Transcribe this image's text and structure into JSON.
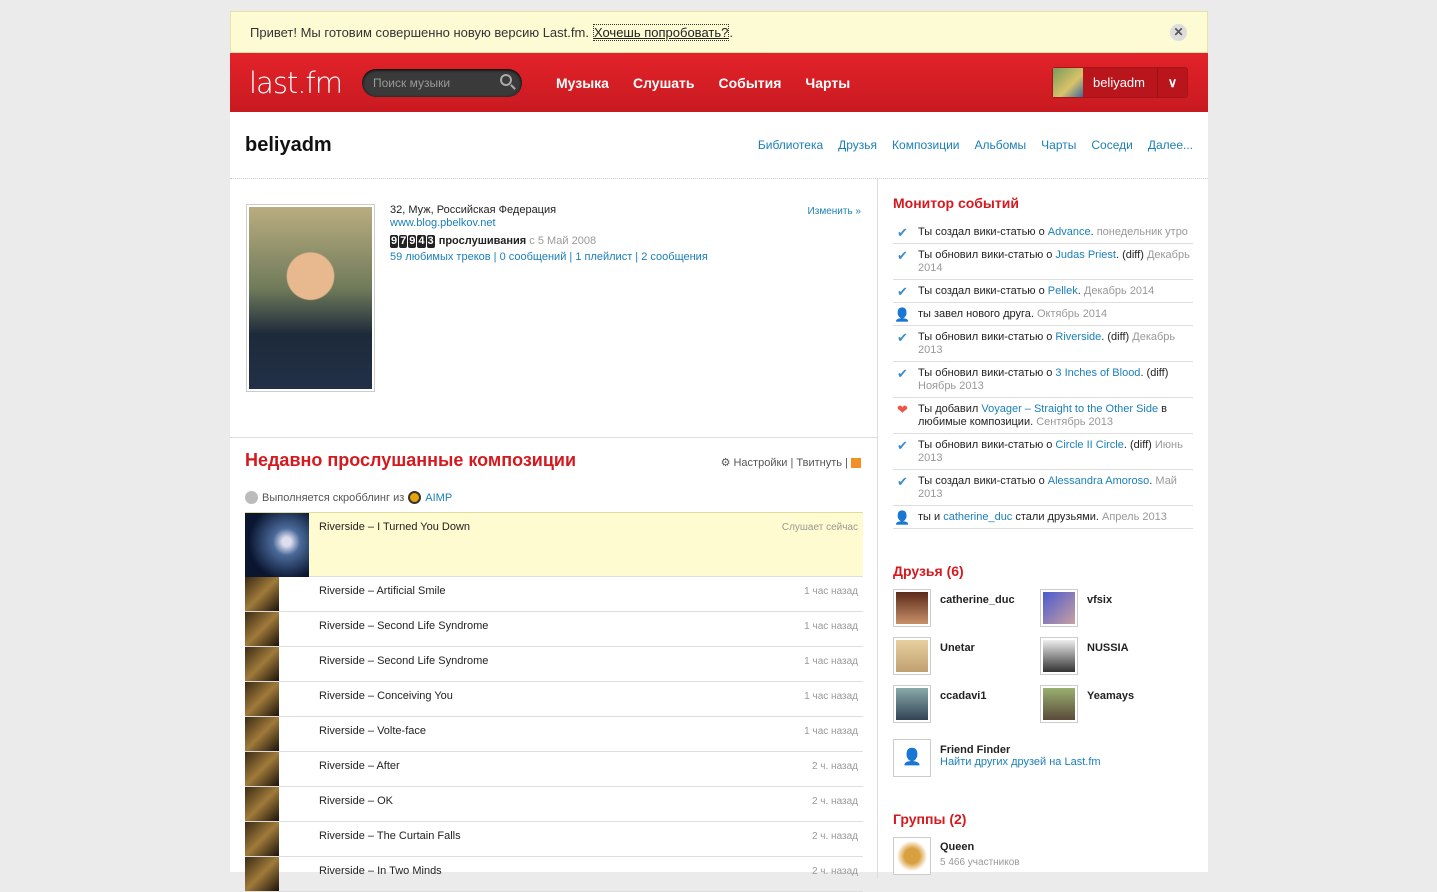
{
  "banner": {
    "text": "Привет! Мы готовим совершенно новую версию Last.fm.",
    "link": "Хочешь попробовать?",
    "after": ".",
    "close": "✕"
  },
  "header": {
    "logo": "last.fm",
    "search_placeholder": "Поиск музыки",
    "nav": [
      "Музыка",
      "Слушать",
      "События",
      "Чарты"
    ],
    "user": "beliyadm",
    "dropdown": "∨"
  },
  "profile": {
    "name": "beliyadm",
    "tabs": [
      "Библиотека",
      "Друзья",
      "Композиции",
      "Альбомы",
      "Чарты",
      "Соседи",
      "Далее..."
    ],
    "details": "32, Муж, Российская Федерация",
    "site": "www.blog.pbelkov.net",
    "edit": "Изменить »",
    "digits": [
      "9",
      "7",
      "9",
      "4",
      "3"
    ],
    "plays_label": "прослушивания",
    "since": "с 5 Май 2008",
    "stats": [
      "59 любимых треков",
      "0 сообщений",
      "1 плейлист",
      "2 сообщения"
    ],
    "sep": " | "
  },
  "recent": {
    "title": "Недавно прослушанные композиции",
    "settings": "⚙ Настройки",
    "tweet": "Твитнуть",
    "sep": " | ",
    "scrobbling": "Выполняется скробблинг из",
    "app": "AIMP",
    "tracks": [
      {
        "name": "Riverside – I Turned You Down",
        "time": "Слушает сейчас"
      },
      {
        "name": "Riverside – Artificial Smile",
        "time": "1 час назад"
      },
      {
        "name": "Riverside – Second Life Syndrome",
        "time": "1 час назад"
      },
      {
        "name": "Riverside – Second Life Syndrome",
        "time": "1 час назад"
      },
      {
        "name": "Riverside – Conceiving You",
        "time": "1 час назад"
      },
      {
        "name": "Riverside – Volte-face",
        "time": "1 час назад"
      },
      {
        "name": "Riverside – After",
        "time": "2 ч. назад"
      },
      {
        "name": "Riverside – OK",
        "time": "2 ч. назад"
      },
      {
        "name": "Riverside – The Curtain Falls",
        "time": "2 ч. назад"
      },
      {
        "name": "Riverside – In Two Minds",
        "time": "2 ч. назад"
      }
    ]
  },
  "events": {
    "title": "Монитор событий",
    "items": [
      {
        "icon": "check",
        "pre": "Ты создал вики-статью о ",
        "link": "Advance",
        "post": ". ",
        "date": "понедельник утро"
      },
      {
        "icon": "check",
        "pre": "Ты обновил вики-статью о ",
        "link": "Judas Priest",
        "post": ". (diff) ",
        "date": "Декабрь 2014"
      },
      {
        "icon": "check",
        "pre": "Ты создал вики-статью о ",
        "link": "Pellek",
        "post": ". ",
        "date": "Декабрь 2014"
      },
      {
        "icon": "person",
        "pre": "ты завел нового друга. ",
        "link": "",
        "post": "",
        "date": "Октябрь 2014"
      },
      {
        "icon": "check",
        "pre": "Ты обновил вики-статью о ",
        "link": "Riverside",
        "post": ". (diff) ",
        "date": "Декабрь 2013"
      },
      {
        "icon": "check",
        "pre": "Ты обновил вики-статью о ",
        "link": "3 Inches of Blood",
        "post": ". (diff) ",
        "date": "Ноябрь 2013"
      },
      {
        "icon": "heart",
        "pre": "Ты добавил ",
        "link": "Voyager – Straight to the Other Side",
        "post": " в любимые композиции. ",
        "date": "Сентябрь 2013"
      },
      {
        "icon": "check",
        "pre": "Ты обновил вики-статью о ",
        "link": "Circle II Circle",
        "post": ". (diff) ",
        "date": "Июнь 2013"
      },
      {
        "icon": "check",
        "pre": "Ты создал вики-статью о ",
        "link": "Alessandra Amoroso",
        "post": ". ",
        "date": "Май 2013"
      },
      {
        "icon": "person",
        "pre": "ты и ",
        "link": "catherine_duc",
        "post": " стали друзьями. ",
        "date": "Апрель 2013"
      }
    ]
  },
  "friends": {
    "title": "Друзья (6)",
    "items": [
      "catherine_duc",
      "vfsix",
      "Unetar",
      "NUSSIA",
      "ccadavi1",
      "Yeamays"
    ],
    "finder_title": "Friend Finder",
    "finder_link": "Найти других друзей на Last.fm"
  },
  "groups": {
    "title": "Группы (2)",
    "items": [
      {
        "name": "Queen",
        "members": "5 466 участников"
      }
    ]
  },
  "colors": {
    "brand": "#d51007",
    "link": "#1a7fb8"
  }
}
